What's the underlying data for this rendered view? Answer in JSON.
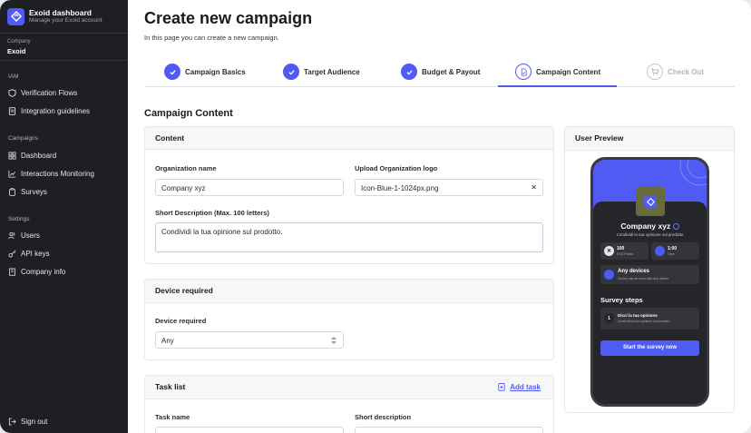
{
  "app": {
    "title": "Exoid dashboard",
    "subtitle": "Manage your Exoid account"
  },
  "company": {
    "label": "Company",
    "value": "Exoid"
  },
  "sidebar": {
    "sections": [
      "IAM",
      "Campaigns",
      "Settings"
    ],
    "iam": [
      "Verification Flows",
      "Integration guidelines"
    ],
    "campaigns": [
      "Dashboard",
      "Interactions Monitoring",
      "Surveys"
    ],
    "settings": [
      "Users",
      "API keys",
      "Company info"
    ],
    "signout": "Sign out"
  },
  "page": {
    "title": "Create new campaign",
    "subtitle": "In this page you can create a new campaign."
  },
  "steps": [
    {
      "label": "Campaign Basics",
      "state": "done"
    },
    {
      "label": "Target Audience",
      "state": "done"
    },
    {
      "label": "Budget & Payout",
      "state": "done"
    },
    {
      "label": "Campaign Content",
      "state": "active"
    },
    {
      "label": "Check Out",
      "state": "disabled"
    }
  ],
  "section_title": "Campaign Content",
  "content": {
    "title": "Content",
    "org_label": "Organization name",
    "org_value": "Company xyz",
    "logo_label": "Upload Organization logo",
    "logo_value": "Icon-Blue-1-1024px.png",
    "desc_label": "Short Description (Max. 100 letters)",
    "desc_value": "Condividi la tua opinione sul prodotto."
  },
  "device": {
    "title": "Device required",
    "label": "Device required",
    "value": "Any"
  },
  "tasks": {
    "title": "Task list",
    "add_label": "Add task",
    "col1": "Task name",
    "col2": "Short description"
  },
  "preview": {
    "title": "User Preview",
    "company": "Company xyz",
    "desc": "Condividi la tua opinione sul prodotto",
    "stat1_value": "100",
    "stat1_label": "EXO Points",
    "stat2_value": "1:00",
    "stat2_label": "Time",
    "device_title": "Any devices",
    "device_sub": "Survey can be done with any device",
    "steps_title": "Survey steps",
    "step1_num": "1",
    "step1_title": "Dicci la tua opinione",
    "step1_sub": "Condividi la tua opinione sul prodotto",
    "button": "Start the survey now"
  },
  "colors": {
    "accent": "#4f5bf3",
    "sidebar": "#1e1f22"
  }
}
